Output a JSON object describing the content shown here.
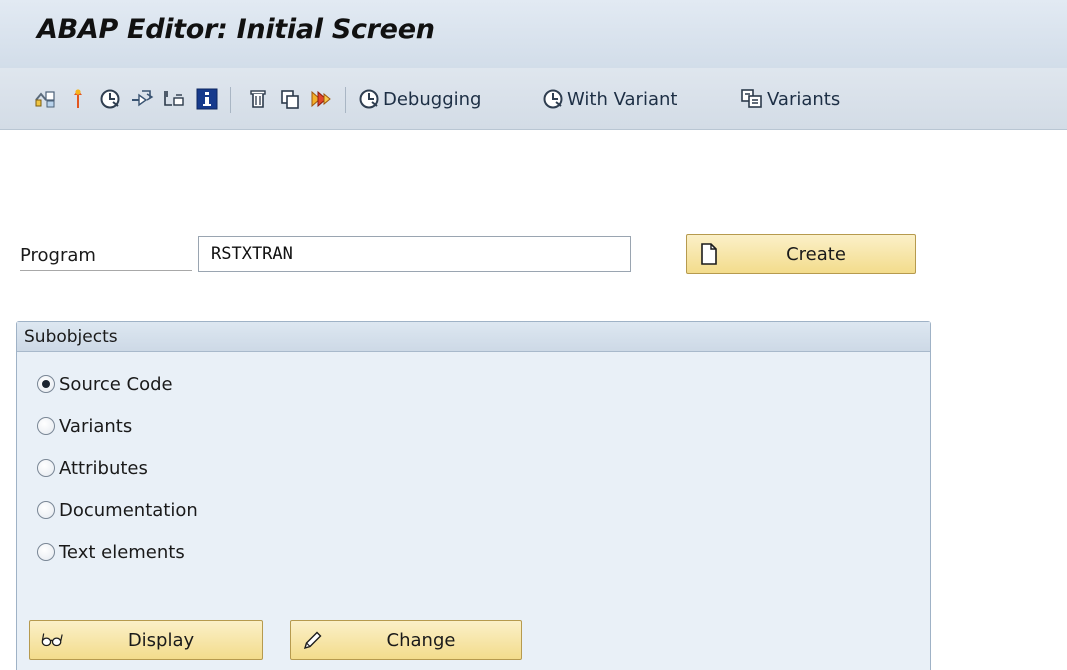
{
  "window": {
    "title": "ABAP Editor: Initial Screen"
  },
  "toolbar": {
    "icons": [
      {
        "name": "object-list-icon"
      },
      {
        "name": "where-used-list-icon"
      },
      {
        "name": "execute-icon"
      },
      {
        "name": "navigation-icon"
      },
      {
        "name": "object-check-icon"
      },
      {
        "name": "information-icon"
      },
      {
        "name": "delete-icon"
      },
      {
        "name": "copy-icon"
      },
      {
        "name": "rename-icon"
      }
    ],
    "debugging_label": "Debugging",
    "with_variant_label": "With Variant",
    "variants_label": "Variants"
  },
  "program": {
    "label": "Program",
    "value": "RSTXTRAN"
  },
  "create_button": {
    "label": "Create"
  },
  "subobjects": {
    "title": "Subobjects",
    "options": [
      {
        "label": "Source Code",
        "checked": true
      },
      {
        "label": "Variants",
        "checked": false
      },
      {
        "label": "Attributes",
        "checked": false
      },
      {
        "label": "Documentation",
        "checked": false
      },
      {
        "label": "Text elements",
        "checked": false
      }
    ]
  },
  "display_button": {
    "label": "Display"
  },
  "change_button": {
    "label": "Change"
  },
  "colors": {
    "title_bar": "#d9e3ee",
    "button_fill": "#f5e09a",
    "group_background": "#e9f0f7"
  }
}
